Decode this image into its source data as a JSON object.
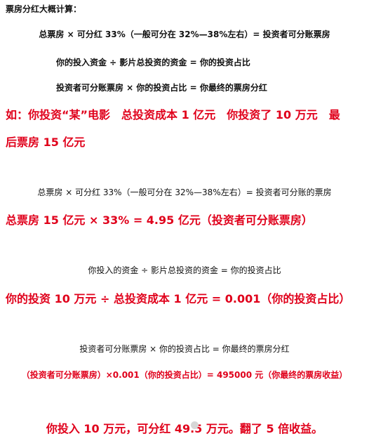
{
  "intro": {
    "heading": "票房分红大概计算：",
    "formula1": "总票房 × 可分红 33%（一般可分在 32%—38%左右）= 投资者可分账票房",
    "formula2": "你的投入资金 ÷ 影片总投资的资金 = 你的投资占比",
    "formula3": "投资者可分账票房 × 你的投资占比 = 你最终的票房分红"
  },
  "example": {
    "line1": "如：你投资“某”电影　总投资成本 1 亿元　你投资了 10 万元　最",
    "line2": "后票房 15 亿元"
  },
  "step1": {
    "formula": "总票房 × 可分红 33%（一般可分在 32%—38%左右）= 投资者可分账的票房",
    "result": "总票房 15 亿元 × 33% = 4.95 亿元（投资者可分账票房）"
  },
  "step2": {
    "formula": "你投入的资金 ÷ 影片总投资的资金 = 你的投资占比",
    "result": "你的投资 10 万元 ÷ 总投资成本 1 亿元 = 0.001（你的投资占比）"
  },
  "step3": {
    "formula": "投资者可分账票房 × 你的投资占比 = 你最终的票房分红",
    "result": "（投资者可分账票房）×0.001（你的投资占比）= 495000 元（你最终的票房收益）"
  },
  "conclusion": "你投入 10 万元，可分红 49.5 万元。翻了 5 倍收益。",
  "colors": {
    "text": "#111111",
    "highlight": "#e0001b",
    "background": "#ffffff"
  }
}
